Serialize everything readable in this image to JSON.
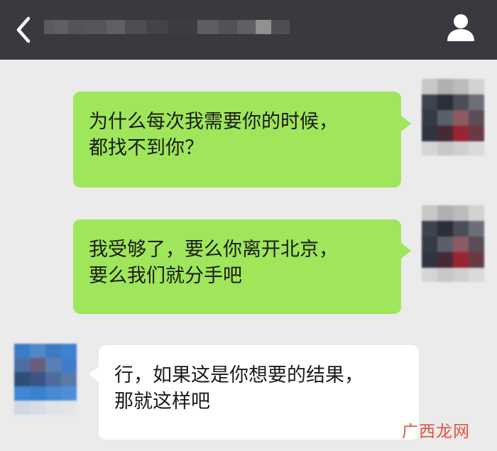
{
  "header": {
    "back_icon": "chevron-left-icon",
    "contact_name": "",
    "profile_icon": "person-icon",
    "bar_color": "#393a3f"
  },
  "messages": [
    {
      "side": "right",
      "bubble_color": "#9fe65a",
      "lines": [
        "为什么每次我需要你的时候，",
        "都找不到你？"
      ]
    },
    {
      "side": "right",
      "bubble_color": "#9fe65a",
      "lines": [
        "我受够了，要么你离开北京，",
        "要么我们就分手吧"
      ]
    },
    {
      "side": "left",
      "bubble_color": "#ffffff",
      "lines": [
        "行，如果这是你想要的结果，",
        "那就这样吧"
      ]
    }
  ],
  "watermark": "广西龙网"
}
